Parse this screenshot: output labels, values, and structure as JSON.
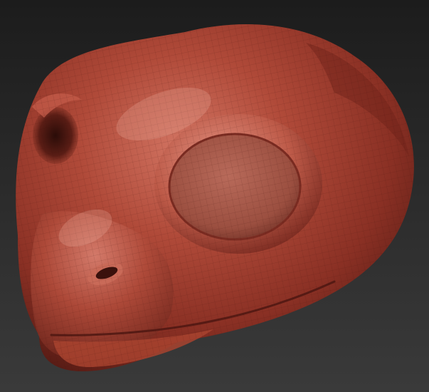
{
  "scene": {
    "subject": "sculpted-reptile-head",
    "colors": {
      "background_top": "#1c1c1c",
      "background_bottom": "#3a3a3a",
      "clay_base": "#9a3a2c",
      "clay_highlight": "#d57a68",
      "clay_shadow": "#4a1712",
      "eye_socket": "#a85848"
    }
  }
}
